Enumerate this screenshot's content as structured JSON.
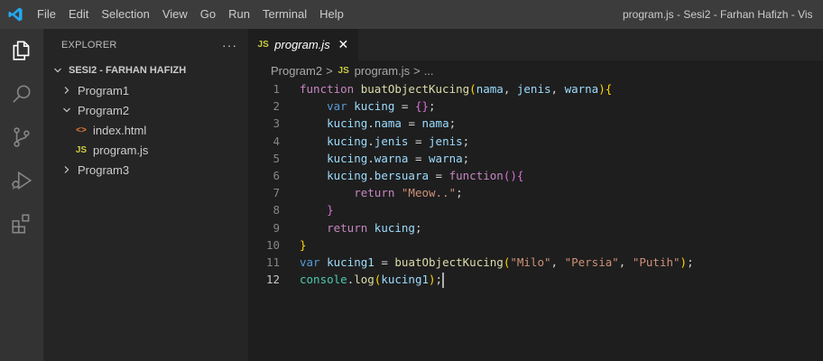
{
  "menu": [
    "File",
    "Edit",
    "Selection",
    "View",
    "Go",
    "Run",
    "Terminal",
    "Help"
  ],
  "window_title": "program.js - Sesi2 - Farhan Hafizh - Vis",
  "sidebar": {
    "title": "EXPLORER",
    "more": "···",
    "section": "SESI2 - FARHAN HAFIZH",
    "items": [
      {
        "label": "Program1",
        "type": "folder",
        "expanded": false
      },
      {
        "label": "Program2",
        "type": "folder",
        "expanded": true
      },
      {
        "label": "index.html",
        "type": "html"
      },
      {
        "label": "program.js",
        "type": "js"
      },
      {
        "label": "Program3",
        "type": "folder",
        "expanded": false
      }
    ]
  },
  "editor": {
    "tab": {
      "icon": "JS",
      "label": "program.js",
      "close": "✕"
    },
    "breadcrumb": {
      "folder": "Program2",
      "sep": ">",
      "icon": "JS",
      "file": "program.js",
      "tail": "..."
    },
    "line_numbers": [
      "1",
      "2",
      "3",
      "4",
      "5",
      "6",
      "7",
      "8",
      "9",
      "10",
      "11",
      "12"
    ],
    "active_line": "12",
    "code": [
      "function buatObjectKucing(nama, jenis, warna){",
      "    var kucing = {};",
      "    kucing.nama = nama;",
      "    kucing.jenis = jenis;",
      "    kucing.warna = warna;",
      "    kucing.bersuara = function(){",
      "        return \"Meow..\";",
      "    }",
      "    return kucing;",
      "}",
      "var kucing1 = buatObjectKucing(\"Milo\", \"Persia\", \"Putih\");",
      "console.log(kucing1);"
    ]
  },
  "colors": {
    "titlebar": "#3c3c3c",
    "activitybar": "#333333",
    "sidebar": "#252526",
    "editor": "#1e1e1e",
    "logo": "#23a9f2"
  },
  "icons": {
    "activity": [
      "files-icon",
      "search-icon",
      "source-control-icon",
      "run-debug-icon",
      "extensions-icon"
    ]
  }
}
